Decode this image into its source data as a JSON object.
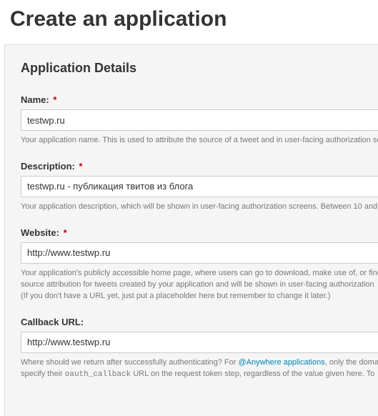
{
  "page_title": "Create an application",
  "panel_heading": "Application Details",
  "fields": {
    "name": {
      "label": "Name:",
      "required": "*",
      "value": "testwp.ru",
      "help": "Your application name. This is used to attribute the source of a tweet and in user-facing authorization sc"
    },
    "description": {
      "label": "Description:",
      "required": "*",
      "value": "testwp.ru - публикация твитов из блога",
      "help": "Your application description, which will be shown in user-facing authorization screens. Between 10 and"
    },
    "website": {
      "label": "Website:",
      "required": "*",
      "value": "http://www.testwp.ru",
      "help_line1": "Your application's publicly accessible home page, where users can go to download, make use of, or find",
      "help_line2": "source attribution for tweets created by your application and will be shown in user-facing authorization",
      "help_line3": "(If you don't have a URL yet, just put a placeholder here but remember to change it later.)"
    },
    "callback": {
      "label": "Callback URL:",
      "value": "http://www.testwp.ru",
      "help_pre": "Where should we return after successfully authenticating? For ",
      "help_link": "@Anywhere applications",
      "help_post": ", only the doma",
      "help_line2_pre": "specify their ",
      "help_code": "oauth_callback",
      "help_line2_post": " URL on the request token step, regardless of the value given here. To"
    }
  }
}
